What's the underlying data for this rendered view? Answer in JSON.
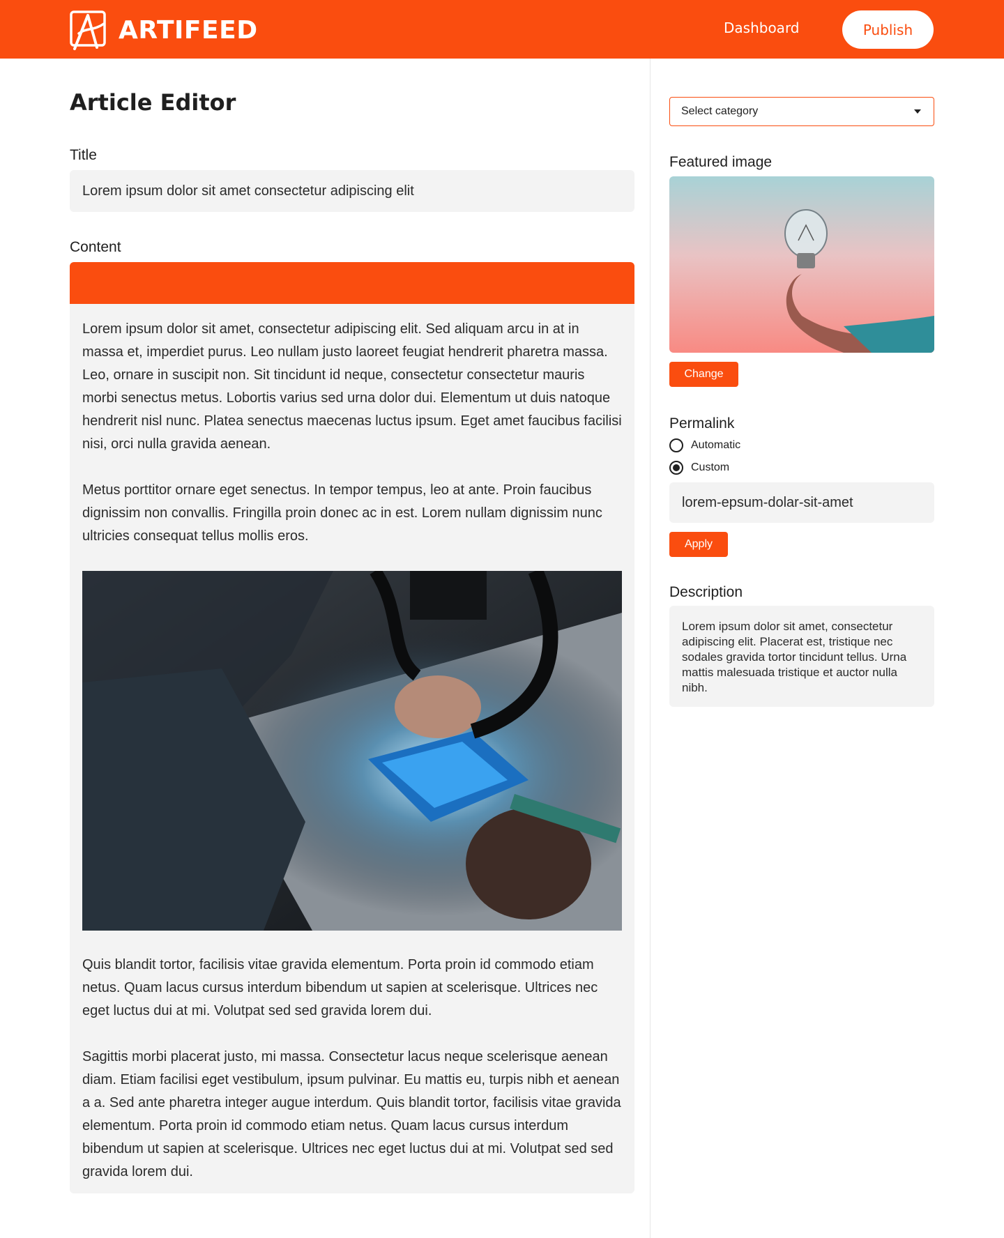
{
  "header": {
    "brand": "ARTIFEED",
    "nav_dashboard": "Dashboard",
    "publish_label": "Publish",
    "accent_color": "#fa4d0f"
  },
  "editor": {
    "page_title": "Article Editor",
    "title_label": "Title",
    "title_value": "Lorem ipsum dolor sit amet consectetur adipiscing elit",
    "content_label": "Content",
    "paragraphs": [
      "Lorem ipsum dolor sit amet, consectetur adipiscing elit. Sed aliquam arcu in at in massa et, imperdiet purus. Leo nullam justo laoreet feugiat hendrerit pharetra massa. Leo, ornare in suscipit non. Sit tincidunt id neque, consectetur consectetur mauris morbi senectus metus. Lobortis varius sed urna dolor dui. Elementum ut duis natoque hendrerit nisl nunc. Platea senectus maecenas luctus ipsum. Eget amet faucibus facilisi nisi, orci nulla gravida aenean.",
      "Metus porttitor ornare eget senectus. In tempor tempus, leo at ante. Proin faucibus dignissim non convallis. Fringilla proin donec ac in est. Lorem nullam dignissim nunc ultricies consequat tellus mollis eros.",
      "Quis blandit tortor, facilisis vitae gravida elementum. Porta proin id commodo etiam netus. Quam lacus cursus interdum bibendum ut sapien at scelerisque. Ultrices nec eget luctus dui at mi. Volutpat sed sed gravida lorem dui.",
      "Sagittis morbi placerat justo, mi massa. Consectetur lacus neque scelerisque aenean diam. Etiam facilisi eget vestibulum, ipsum pulvinar. Eu mattis eu, turpis nibh et aenean a a. Sed ante pharetra integer augue interdum. Quis blandit tortor, facilisis vitae gravida elementum. Porta proin id commodo etiam netus. Quam lacus cursus interdum bibendum ut sapien at scelerisque. Ultrices nec eget luctus dui at mi. Volutpat sed sed gravida lorem dui."
    ]
  },
  "sidebar": {
    "category_selected": "Select category",
    "featured_label": "Featured image",
    "change_label": "Change",
    "permalink_label": "Permalink",
    "radio_automatic": "Automatic",
    "radio_custom": "Custom",
    "permalink_value": "lorem-epsum-dolar-sit-amet",
    "apply_label": "Apply",
    "description_label": "Description",
    "description_value": "Lorem ipsum dolor sit amet, consectetur adipiscing elit. Placerat est, tristique nec sodales gravida tortor tincidunt tellus. Urna mattis malesuada tristique et auctor nulla nibh."
  }
}
